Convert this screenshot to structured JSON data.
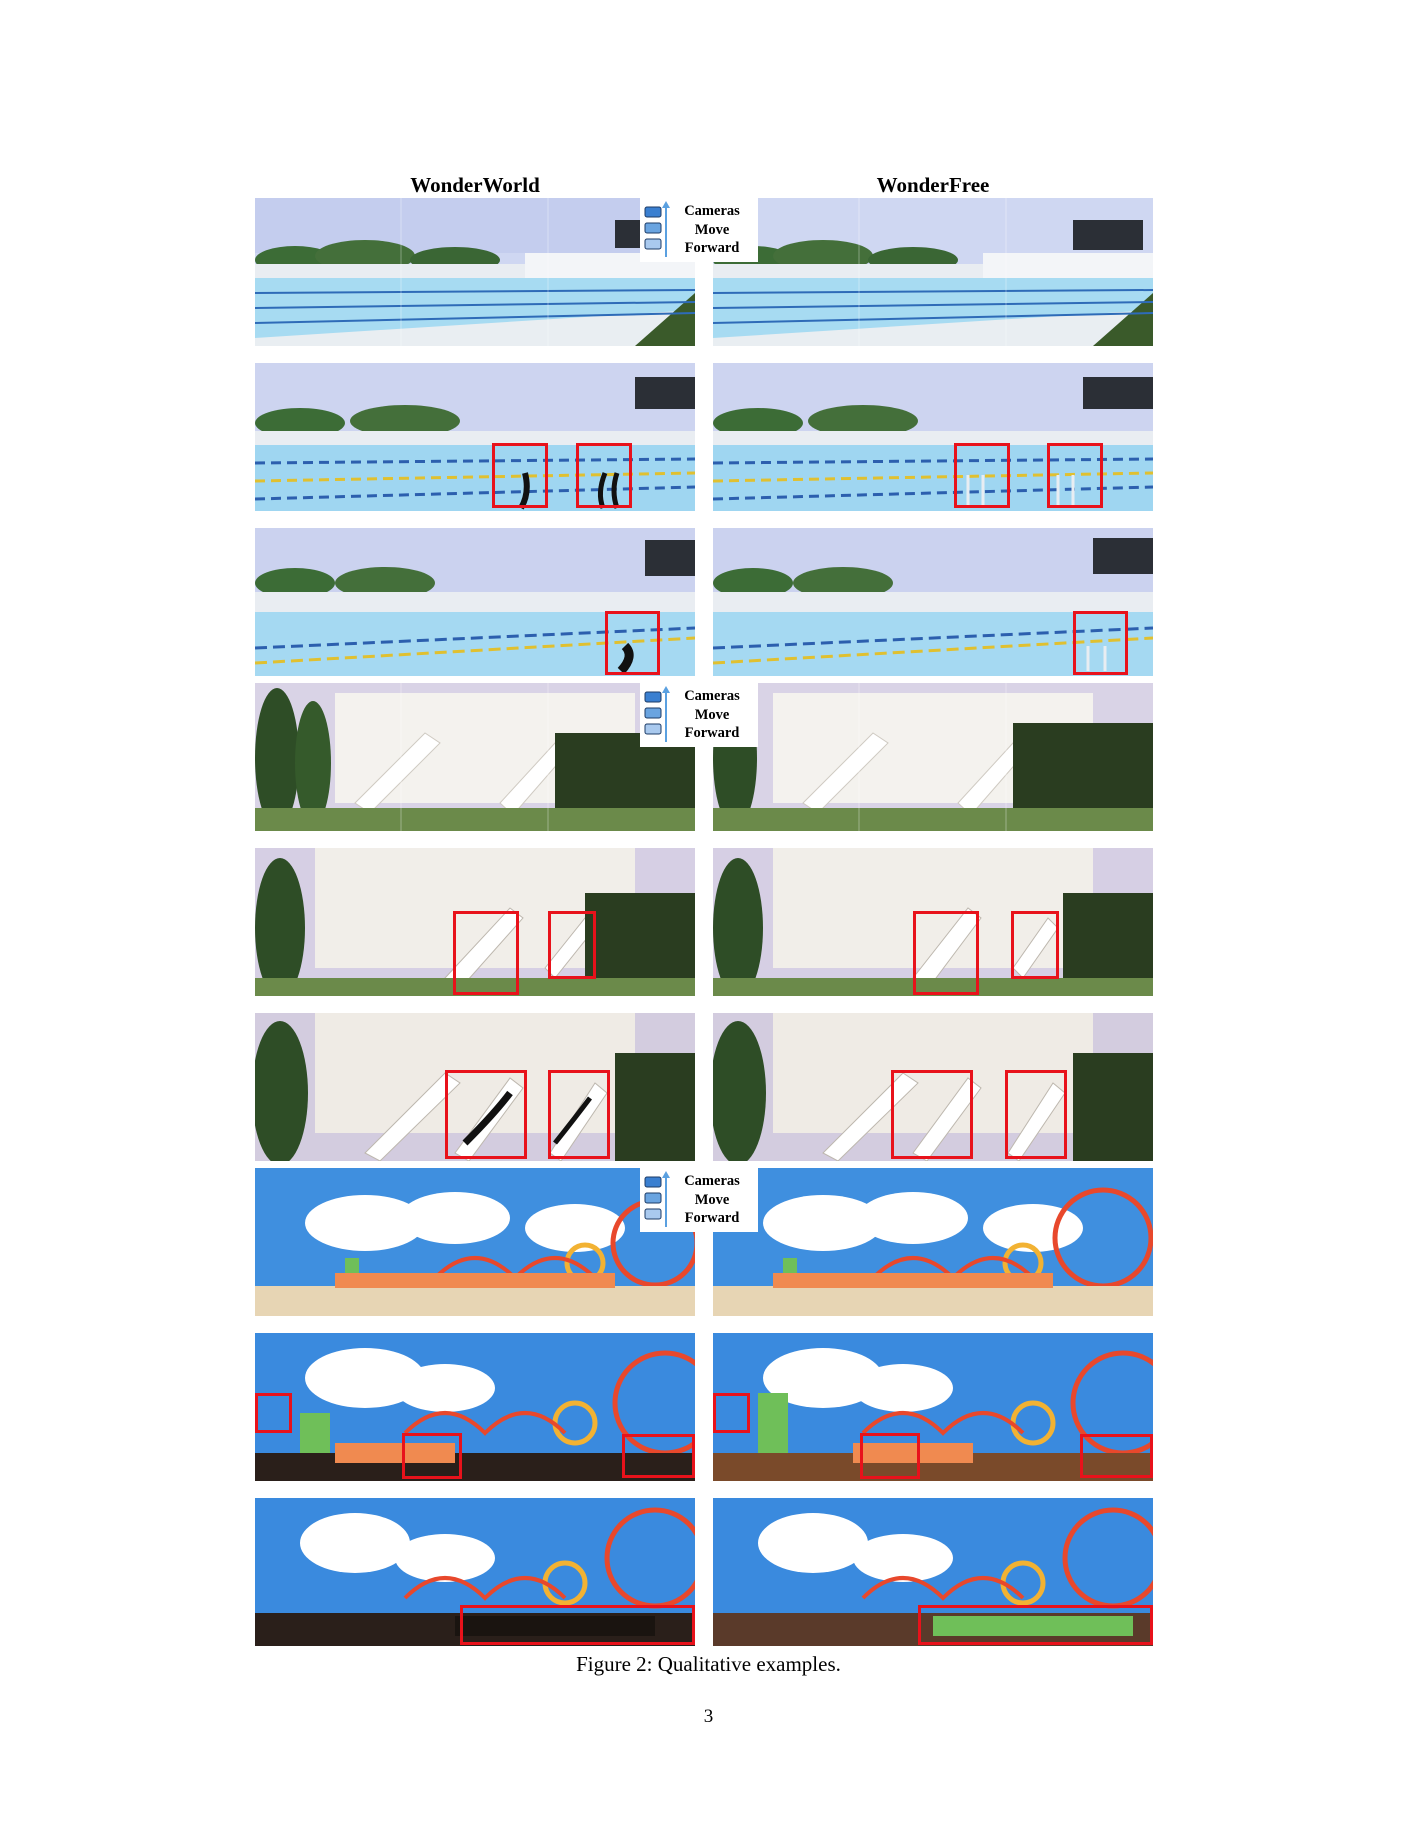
{
  "figure": {
    "columns": {
      "left": "WonderWorld",
      "right": "WonderFree"
    },
    "camera_legend": {
      "line1": "Cameras",
      "line2": "Move",
      "line3": "Forward",
      "icon": "camera-stack-arrow-up-icon"
    },
    "caption": "Figure 2: Qualitative examples.",
    "page_number": "3"
  },
  "scenes": [
    {
      "name": "swimming-pool",
      "sky": "#c9d3f0",
      "accent": "#3d7a2e",
      "ground": "#9cd3ef"
    },
    {
      "name": "white-house-stairs",
      "sky": "#dcd6e8",
      "accent": "#2c4a22",
      "ground": "#f4f2ee"
    },
    {
      "name": "amusement-park",
      "sky": "#3f8fdf",
      "accent": "#e8482c",
      "ground": "#e7d5b4"
    }
  ],
  "colors": {
    "highlight": "#e8121b",
    "arrow": "#5aa0e0"
  }
}
